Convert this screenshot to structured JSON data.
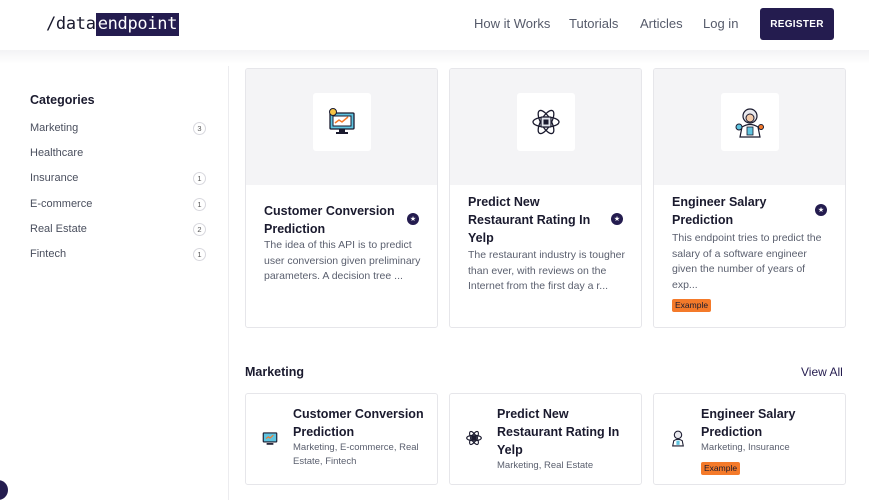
{
  "header": {
    "logo_plain": "/data",
    "logo_box": "endpoint",
    "nav": [
      "How it Works",
      "Tutorials",
      "Articles",
      "Log in"
    ],
    "register_label": "REGISTER"
  },
  "sidebar": {
    "title": "Categories",
    "items": [
      {
        "label": "Marketing",
        "count": "3"
      },
      {
        "label": "Healthcare",
        "count": ""
      },
      {
        "label": "Insurance",
        "count": "1"
      },
      {
        "label": "E-commerce",
        "count": "1"
      },
      {
        "label": "Real Estate",
        "count": "2"
      },
      {
        "label": "Fintech",
        "count": "1"
      }
    ]
  },
  "featured": [
    {
      "title": "Customer Conversion Prediction",
      "description": "The idea of this API is to predict user conversion given preliminary parameters. A decision tree ...",
      "icon": "computer-analytics-icon",
      "badge": ""
    },
    {
      "title": "Predict New Restaurant Rating In Yelp",
      "description": "The restaurant industry is tougher than ever, with reviews on the Internet from the first day a r...",
      "icon": "atom-chip-icon",
      "badge": ""
    },
    {
      "title": "Engineer Salary Prediction",
      "description": "This endpoint tries to predict the salary of a software engineer given the number of years of exp...",
      "icon": "scientist-icon",
      "badge": "Example"
    }
  ],
  "section": {
    "title": "Marketing",
    "view_all": "View All",
    "cards": [
      {
        "title": "Customer Conversion Prediction",
        "tags": "Marketing, E-commerce, Real Estate, Fintech",
        "icon": "computer-analytics-icon",
        "badge": ""
      },
      {
        "title": "Predict New Restaurant Rating In Yelp",
        "tags": "Marketing, Real Estate",
        "icon": "atom-chip-icon",
        "badge": ""
      },
      {
        "title": "Engineer Salary Prediction",
        "tags": "Marketing, Insurance",
        "icon": "scientist-icon",
        "badge": "Example"
      }
    ]
  },
  "colors": {
    "brand": "#241c4f",
    "badge": "#f47a2a"
  }
}
